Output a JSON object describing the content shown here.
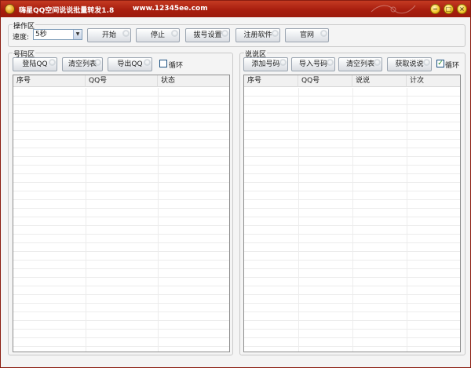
{
  "window": {
    "title": "嗨星QQ空间说说批量转发1.8",
    "url": "www.12345ee.com",
    "accent": "#b2240f"
  },
  "ops": {
    "group_label": "操作区",
    "speed_label": "速度:",
    "speed_value": "5秒",
    "buttons": {
      "start": "开始",
      "stop": "停止",
      "dial": "拔号设置",
      "register": "注册软件",
      "site": "官网"
    }
  },
  "numbers": {
    "group_label": "号码区",
    "buttons": {
      "login": "登陆QQ",
      "clear": "清空列表",
      "export": "导出QQ"
    },
    "loop_label": "循环",
    "loop_checked": false,
    "columns": [
      "序号",
      "QQ号",
      "状态"
    ]
  },
  "shuoshuo": {
    "group_label": "说说区",
    "buttons": {
      "add": "添加号码",
      "import": "导入号码",
      "clear": "清空列表",
      "fetch": "获取说说"
    },
    "loop_label": "循环",
    "loop_checked": true,
    "columns": [
      "序号",
      "QQ号",
      "说说",
      "计次"
    ]
  }
}
